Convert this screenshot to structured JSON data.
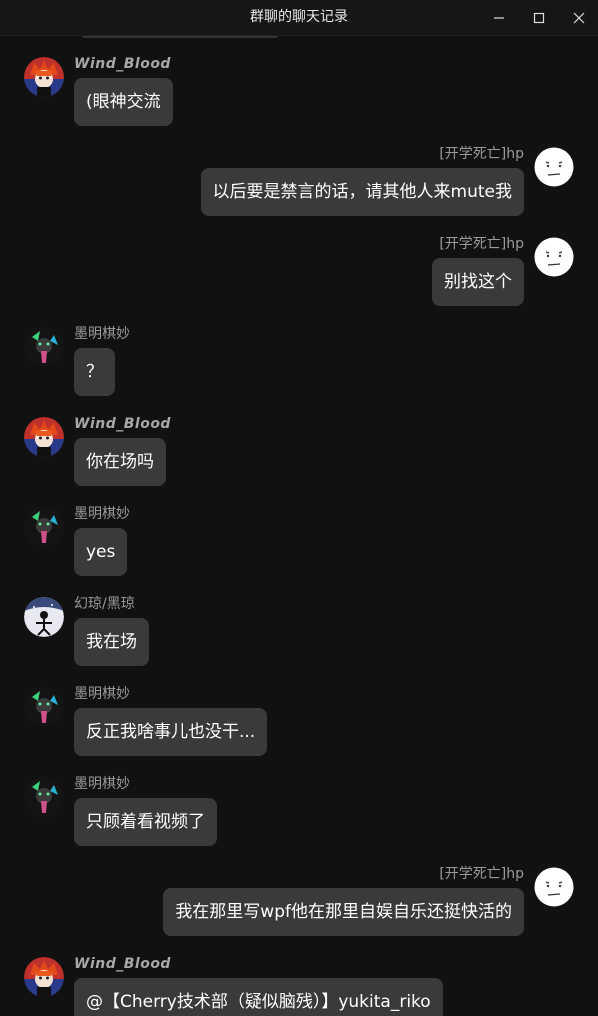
{
  "window": {
    "title": "群聊的聊天记录"
  },
  "messages": [
    {
      "side": "left",
      "avatar": "wind-blood",
      "sender": "Wind_Blood",
      "text": "(眼神交流"
    },
    {
      "side": "right",
      "avatar": "smiley",
      "sender": "[开学死亡]hp",
      "text": "以后要是禁言的话，请其他人来mute我"
    },
    {
      "side": "right",
      "avatar": "smiley",
      "sender": "[开学死亡]hp",
      "text": "别找这个"
    },
    {
      "side": "left",
      "avatar": "moming",
      "sender": "墨明棋妙",
      "text": "？"
    },
    {
      "side": "left",
      "avatar": "wind-blood",
      "sender": "Wind_Blood",
      "text": "你在场吗"
    },
    {
      "side": "left",
      "avatar": "moming",
      "sender": "墨明棋妙",
      "text": "yes"
    },
    {
      "side": "left",
      "avatar": "huanqiong",
      "sender": "幻琼/黑琼",
      "text": "我在场"
    },
    {
      "side": "left",
      "avatar": "moming",
      "sender": "墨明棋妙",
      "text": "反正我啥事儿也没干..."
    },
    {
      "side": "left",
      "avatar": "moming",
      "sender": "墨明棋妙",
      "text": "只顾着看视频了"
    },
    {
      "side": "right",
      "avatar": "smiley",
      "sender": "[开学死亡]hp",
      "text": "我在那里写wpf他在那里自娱自乐还挺快活的"
    },
    {
      "side": "left",
      "avatar": "wind-blood",
      "sender": "Wind_Blood",
      "text": "@【Cherry技术部（疑似脑残）】yukita_riko"
    }
  ]
}
